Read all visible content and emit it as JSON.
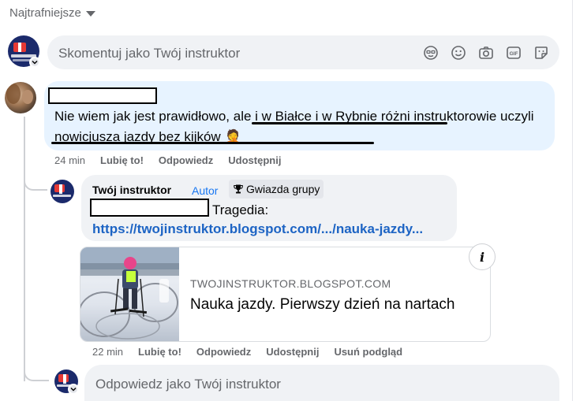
{
  "sort": {
    "label": "Najtrafniejsze"
  },
  "composer": {
    "placeholder": "Skomentuj jako Twój instruktor",
    "icons": [
      "avatar-sticker-icon",
      "emoji-icon",
      "camera-icon",
      "gif-icon",
      "sticker-icon"
    ]
  },
  "comment": {
    "text_start": "Nie wiem jak jest prawidłowo, ",
    "text_underlined": "ale i w Białce i w Rybnie różni instruktorowie uczyli nowicjusza jazdy bez kijków",
    "emoji": "🤦",
    "time": "24 min",
    "like": "Lubię to!",
    "reply": "Odpowiedz",
    "share": "Udostępnij"
  },
  "reply": {
    "author": "Twój instruktor",
    "author_tag": "Autor",
    "badge": "Gwiazda grupy",
    "badge_icon": "trophy-icon",
    "text": "Tragedia:",
    "link": "https://twojinstruktor.blogspot.com/.../nauka-jazdy...",
    "time": "22 min",
    "like": "Lubię to!",
    "reply": "Odpowiedz",
    "share": "Udostępnij",
    "remove_preview": "Usuń podgląd"
  },
  "preview": {
    "domain": "TWOJINSTRUKTOR.BLOGSPOT.COM",
    "title": "Nauka jazdy. Pierwszy dzień na nartach"
  },
  "reply_composer": {
    "placeholder": "Odpowiedz jako Twój instruktor"
  },
  "colors": {
    "link": "#1d64c4",
    "author_tag": "#1877f2",
    "bubble_highlight": "#e7f3ff",
    "bubble": "#f0f2f5"
  }
}
